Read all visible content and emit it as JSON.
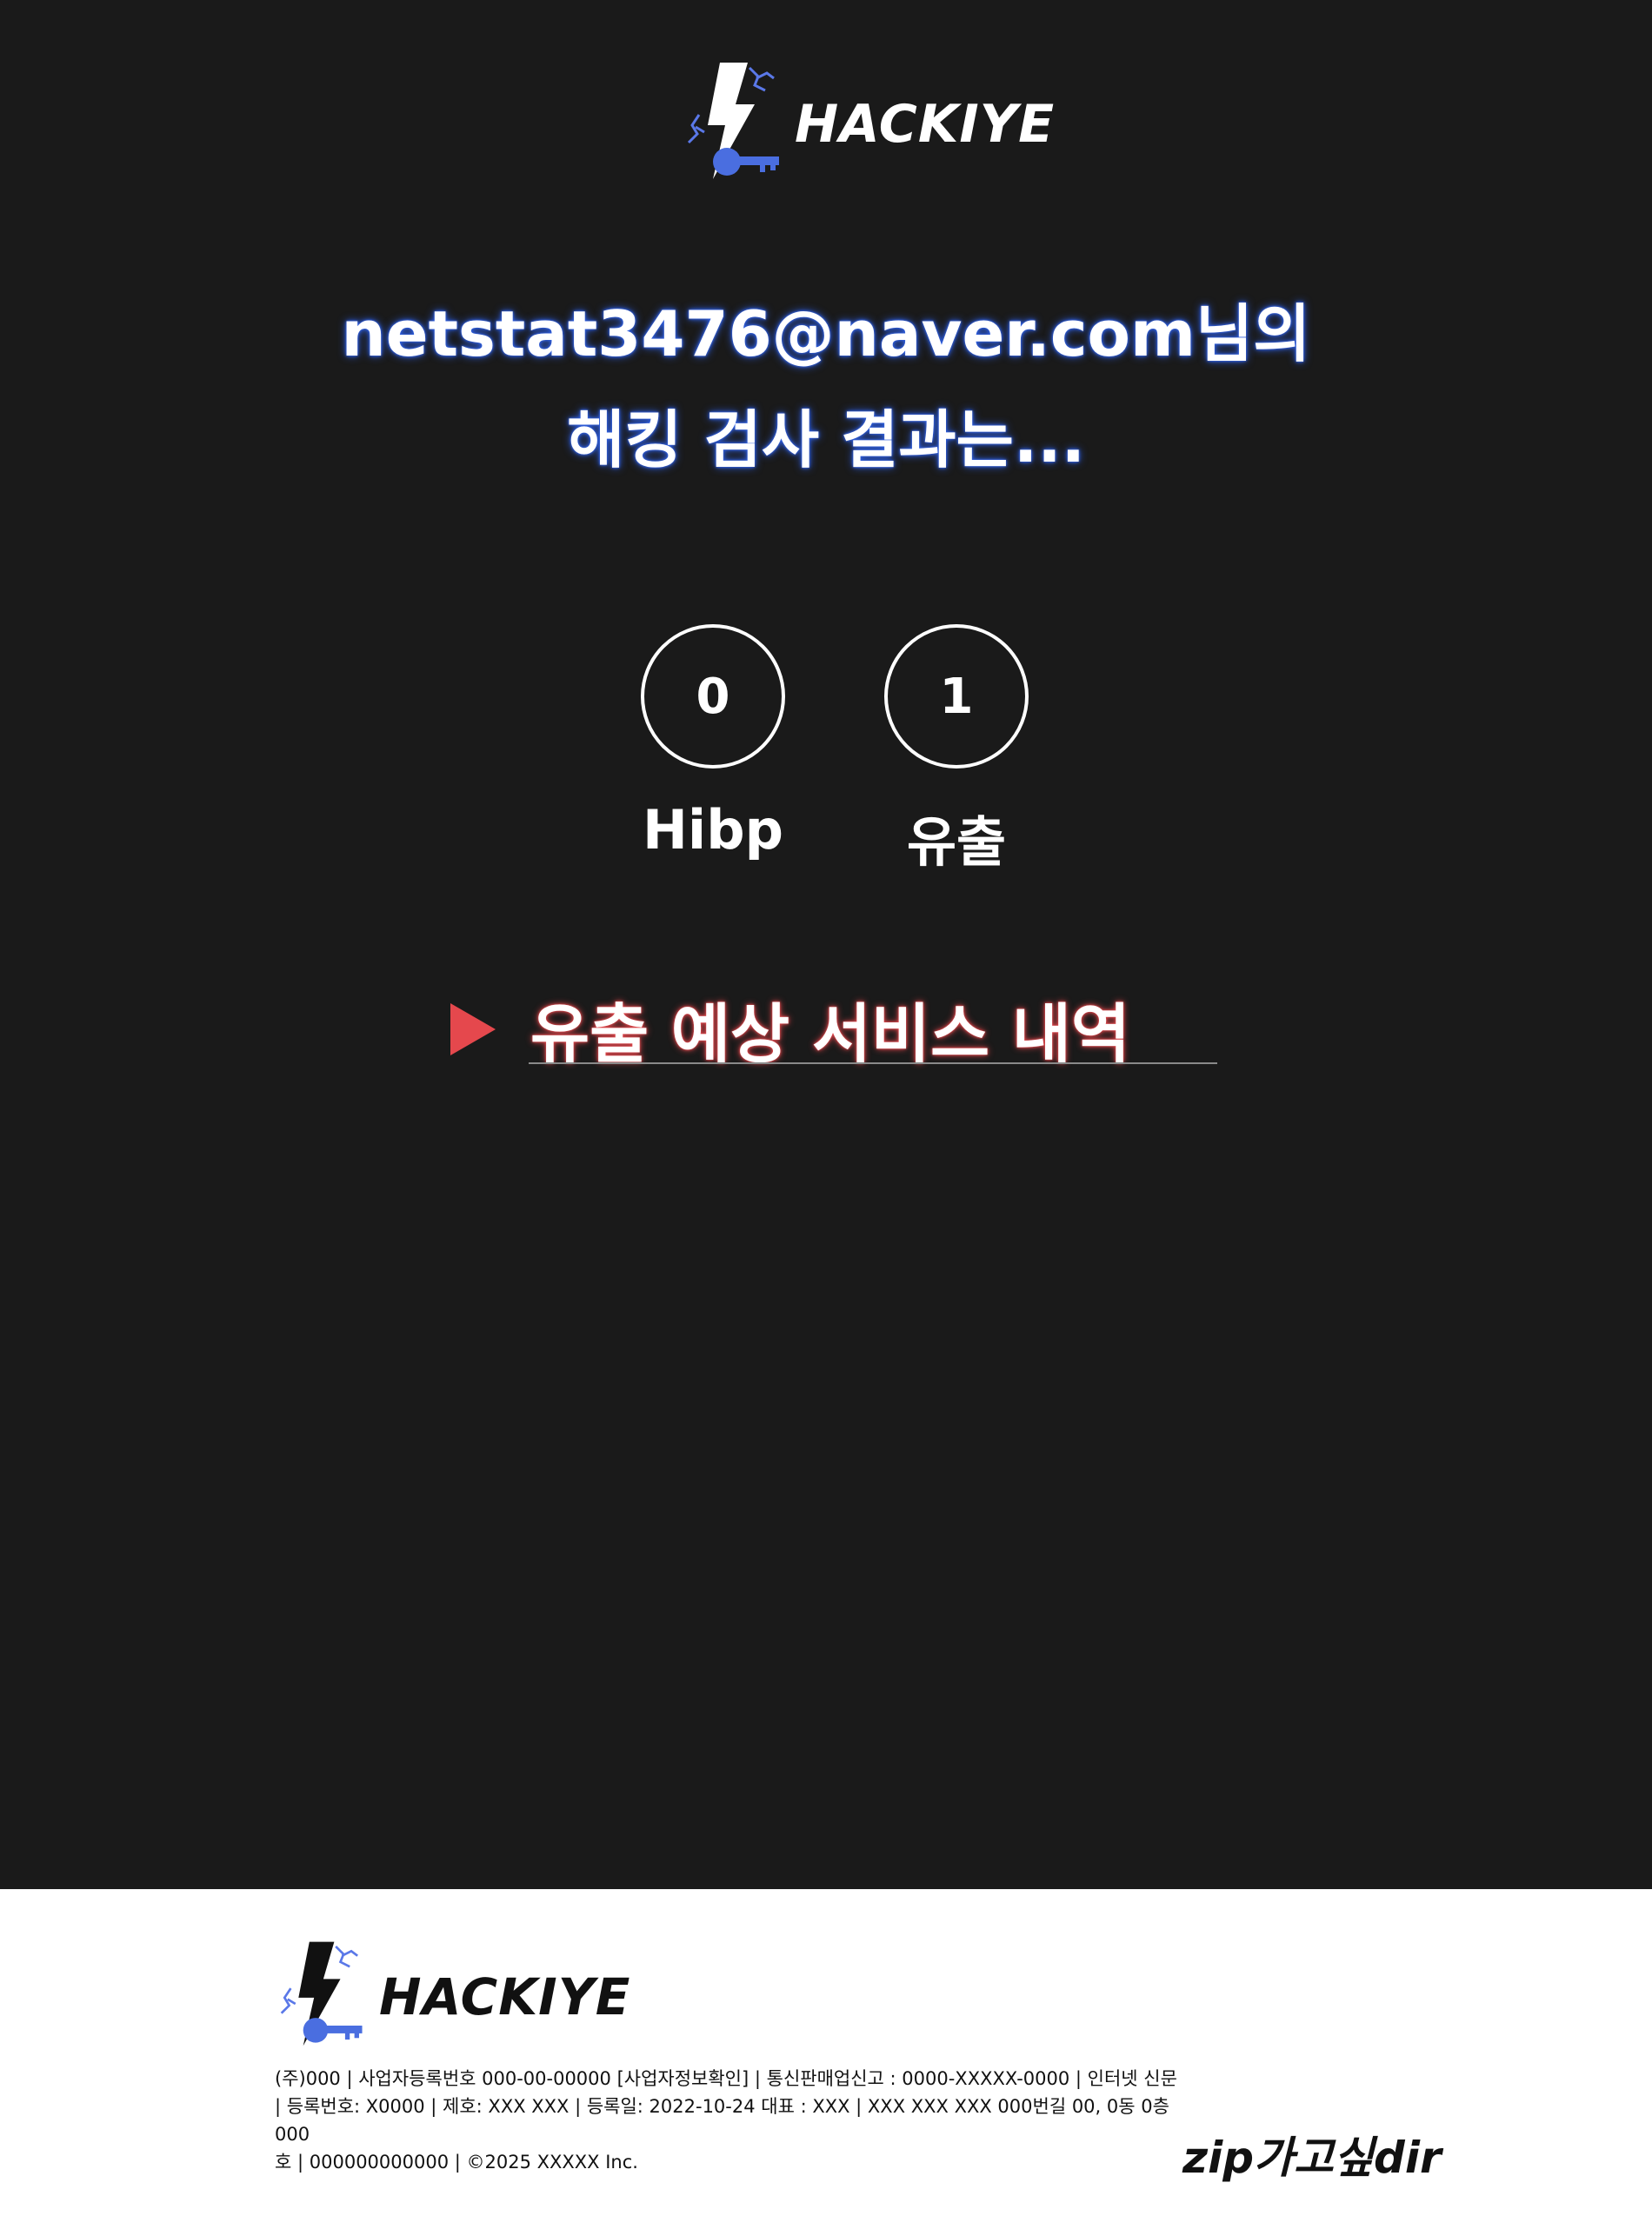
{
  "brand": {
    "name": "HACKIYE"
  },
  "result": {
    "line1": "netstat3476@naver.com님의",
    "line2": "해킹 검사 결과는..."
  },
  "stats": [
    {
      "value": "0",
      "label": "Hibp"
    },
    {
      "value": "1",
      "label": "유출"
    }
  ],
  "section": {
    "title": "유출 예상 서비스 내역"
  },
  "footer": {
    "info_line1": "(주)000 | 사업자등록번호 000-00-00000 [사업자정보확인] | 통신판매업신고 : 0000-XXXXX-0000 | 인터넷 신문",
    "info_line2": "| 등록번호: X0000 | 제호: XXX XXX | 등록일: 2022-10-24 대표 : XXX | XXX XXX XXX 000번길 00, 0동 0층 000",
    "info_line3": "호 | 000000000000 | ©2025 XXXXX Inc.",
    "tagline": "zip가고싶dir"
  },
  "colors": {
    "background": "#1a1a1a",
    "accent_blue": "#4a6ee0",
    "accent_red": "#e5484d",
    "footer_bg": "#ffffff"
  }
}
